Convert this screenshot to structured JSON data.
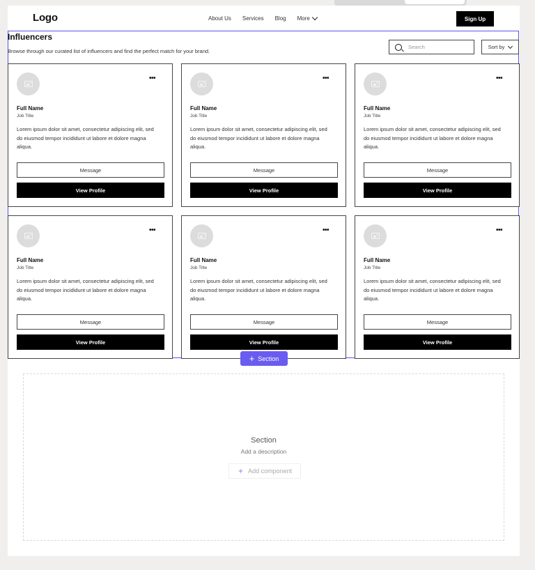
{
  "header": {
    "logo": "Logo",
    "nav": [
      "About Us",
      "Services",
      "Blog",
      "More"
    ],
    "signup_label": "Sign Up"
  },
  "section": {
    "title": "Influencers",
    "subtitle": "Browse through our curated list of influencers and find the perfect match for your brand.",
    "search_placeholder": "Search",
    "sort_label": "Sort by"
  },
  "cards": [
    {
      "name": "Full Name",
      "job": "Job Title",
      "desc": "Lorem ipsum dolor sit amet, consectetur adipiscing elit, sed do eiusmod tempor incididunt ut labore et dolore magna aliqua.",
      "message": "Message",
      "view": "View Profile"
    },
    {
      "name": "Full Name",
      "job": "Job Title",
      "desc": "Lorem ipsum dolor sit amet, consectetur adipiscing elit, sed do eiusmod tempor incididunt ut labore et dolore magna aliqua.",
      "message": "Message",
      "view": "View Profile"
    },
    {
      "name": "Full Name",
      "job": "Job Title",
      "desc": "Lorem ipsum dolor sit amet, consectetur adipiscing elit, sed do eiusmod tempor incididunt ut labore et dolore magna aliqua.",
      "message": "Message",
      "view": "View Profile"
    },
    {
      "name": "Full Name",
      "job": "Job Title",
      "desc": "Lorem ipsum dolor sit amet, consectetur adipiscing elit, sed do eiusmod tempor incididunt ut labore et dolore magna aliqua.",
      "message": "Message",
      "view": "View Profile"
    },
    {
      "name": "Full Name",
      "job": "Job Title",
      "desc": "Lorem ipsum dolor sit amet, consectetur adipiscing elit, sed do eiusmod tempor incididunt ut labore et dolore magna aliqua.",
      "message": "Message",
      "view": "View Profile"
    },
    {
      "name": "Full Name",
      "job": "Job Title",
      "desc": "Lorem ipsum dolor sit amet, consectetur adipiscing elit, sed do eiusmod tempor incididunt ut labore et dolore magna aliqua.",
      "message": "Message",
      "view": "View Profile"
    }
  ],
  "editor": {
    "add_section_label": "Section",
    "empty_title": "Section",
    "empty_desc": "Add a description",
    "add_component_label": "Add component",
    "accent_color": "#6a5cf0"
  }
}
